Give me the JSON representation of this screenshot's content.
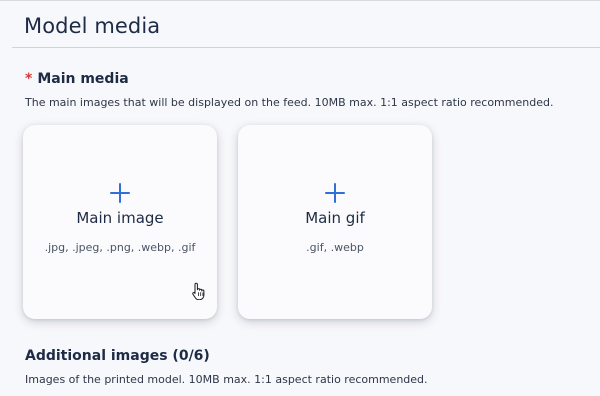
{
  "page": {
    "title": "Model media"
  },
  "main_media": {
    "required_marker": "*",
    "heading": "Main media",
    "description": "The main images that will be displayed on the feed. 10MB max. 1:1 aspect ratio recommended.",
    "tiles": [
      {
        "icon": "plus-icon",
        "label": "Main image",
        "formats": ".jpg, .jpeg, .png, .webp, .gif"
      },
      {
        "icon": "plus-icon",
        "label": "Main gif",
        "formats": ".gif, .webp"
      }
    ]
  },
  "additional_images": {
    "heading": "Additional images (0/6)",
    "description": "Images of the printed model. 10MB max. 1:1 aspect ratio recommended."
  },
  "colors": {
    "accent": "#2f6fd6",
    "required": "#d33b3b",
    "heading": "#1e2b45",
    "background": "#f7f8fb"
  }
}
